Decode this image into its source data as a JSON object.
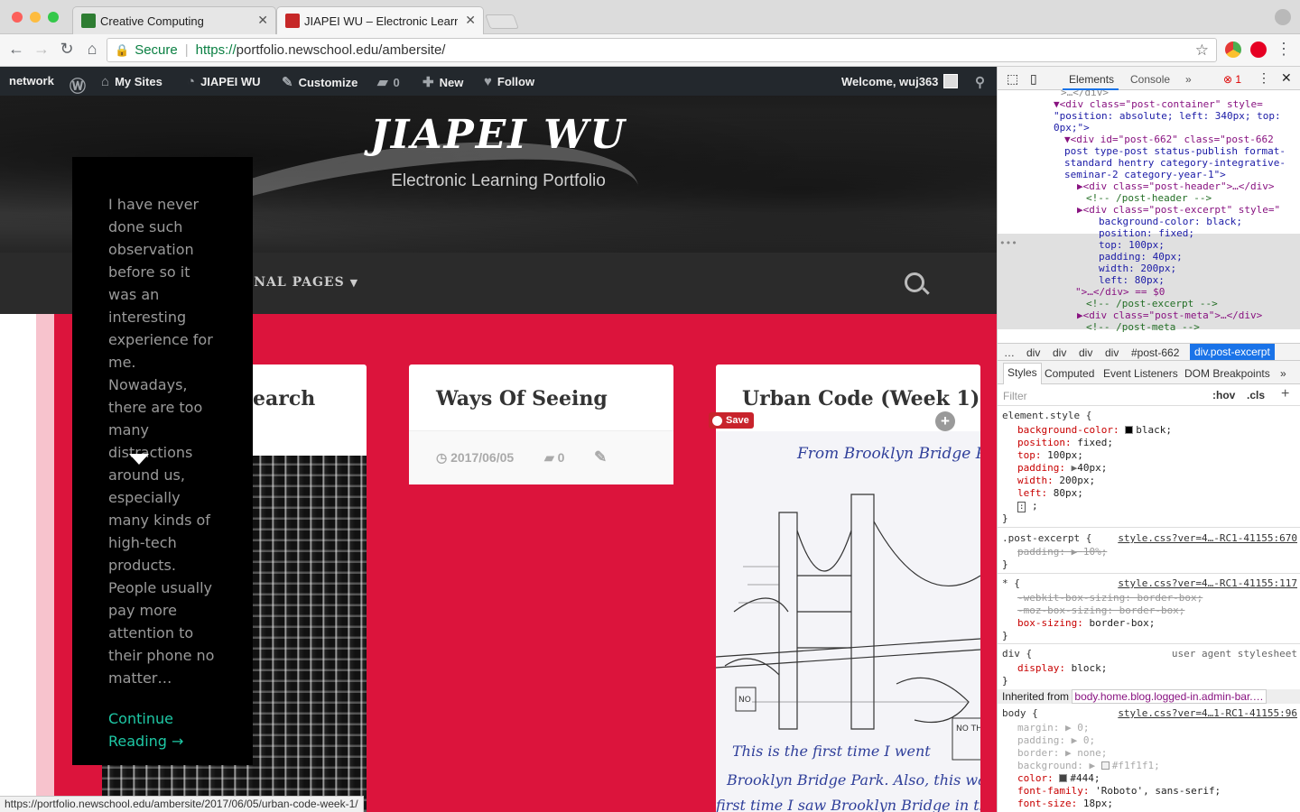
{
  "browser": {
    "tabs": [
      {
        "title": "Creative Computing"
      },
      {
        "title": "JIAPEI WU – Electronic Learnin"
      }
    ],
    "url_secure": "Secure",
    "url_scheme": "https://",
    "url_host": "portfolio.newschool.edu",
    "url_path": "/ambersite/",
    "status_url": "https://portfolio.newschool.edu/ambersite/2017/06/05/urban-code-week-1/"
  },
  "adminbar": {
    "network": "network",
    "my_sites": "My Sites",
    "site_name": "JIAPEI WU",
    "customize": "Customize",
    "comments_count": "0",
    "new": "New",
    "follow": "Follow",
    "welcome": "Welcome, wuj363"
  },
  "header": {
    "title": "JIAPEI WU",
    "description": "Electronic Learning Portfolio"
  },
  "menu": {
    "item": "ONAL PAGES"
  },
  "excerpt": {
    "text": "I have never done such observation before so it was an interesting experience for me. Nowadays, there are too many distractions around us, especially many kinds of high-tech products. People usually pay more attention to their phone no matter…",
    "continue": "Continue Reading →"
  },
  "cards": [
    {
      "title": "earch"
    },
    {
      "title": "Ways Of Seeing",
      "date": "2017/06/05",
      "comments": "0"
    },
    {
      "title": "Urban Code (Week 1)",
      "save_label": "Save"
    }
  ],
  "sketch_text": {
    "top": "From Brooklyn Bridge Par",
    "l1": "This is the first time I went",
    "l2": "Brooklyn Bridge Park. Also, this was th",
    "l3": "first time I saw Brooklyn Bridge in thi",
    "sign1": "NO",
    "sign2": "NO THR TRA"
  },
  "devtools": {
    "tabs": {
      "elements": "Elements",
      "console": "Console",
      "more": "»",
      "errors": "1"
    },
    "dom": [
      {
        "k": "gr",
        "t": ">…</div>"
      },
      {
        "k": "tag",
        "t": "▼<div class=\"post-container\" style="
      },
      {
        "k": "av",
        "t": "\"position: absolute; left: 340px; top:"
      },
      {
        "k": "av",
        "t": "0px;\">"
      },
      {
        "k": "tag",
        "t": "▼<div id=\"post-662\" class=\"post-662"
      },
      {
        "k": "av",
        "t": "post type-post status-publish format-"
      },
      {
        "k": "av",
        "t": "standard hentry category-integrative-"
      },
      {
        "k": "av",
        "t": "seminar-2 category-year-1\">"
      },
      {
        "k": "tag",
        "t": "▶<div class=\"post-header\">…</div>"
      },
      {
        "k": "cm",
        "t": "<!-- /post-header -->"
      },
      {
        "k": "tag",
        "t": "▶<div class=\"post-excerpt\" style=\""
      },
      {
        "k": "av",
        "t": "background-color: black;"
      },
      {
        "k": "av",
        "t": "position: fixed;"
      },
      {
        "k": "av",
        "t": "top: 100px;"
      },
      {
        "k": "av",
        "t": "padding: 40px;"
      },
      {
        "k": "av",
        "t": "width: 200px;"
      },
      {
        "k": "av",
        "t": "left: 80px;"
      },
      {
        "k": "tag",
        "t": "\">…</div> == $0"
      },
      {
        "k": "cm",
        "t": "<!-- /post-excerpt -->"
      },
      {
        "k": "tag",
        "t": "▶<div class=\"post-meta\">…</div>"
      },
      {
        "k": "cm",
        "t": "<!-- /post-meta -->"
      }
    ],
    "crumbs": [
      "…",
      "div",
      "div",
      "div",
      "div",
      "#post-662",
      "div.post-excerpt"
    ],
    "style_tabs": [
      "Styles",
      "Computed",
      "Event Listeners",
      "DOM Breakpoints",
      "»"
    ],
    "filter": "Filter",
    "hov": ":hov",
    "cls": ".cls",
    "rules": {
      "element_sel": "element.style {",
      "e1": "background-color:",
      "e1v": "black;",
      "e2": "position:",
      "e2v": "fixed;",
      "e3": "top:",
      "e3v": "100px;",
      "e4": "padding:",
      "e4v": "40px;",
      "e5": "width:",
      "e5v": "200px;",
      "e6": "left:",
      "e6v": "80px;",
      "e7": ";",
      "close": "}",
      "pe_sel": ".post-excerpt {",
      "pe_src": "style.css?ver=4…-RC1-41155:670",
      "pe1": "padding:",
      "pe1v": "10%;",
      "star_sel": "* {",
      "star_src": "style.css?ver=4…-RC1-41155:117",
      "s1": "-webkit-box-sizing: border-box;",
      "s2": "-moz-box-sizing: border-box;",
      "s3": "box-sizing:",
      "s3v": "border-box;",
      "div_sel": "div {",
      "div_src": "user agent stylesheet",
      "d1": "display:",
      "d1v": "block;",
      "inh_label": "Inherited from",
      "inh_sel": "body.home.blog.logged-in.admin-bar.…",
      "body_sel": "body {",
      "body_src": "style.css?ver=4…1-RC1-41155:96",
      "b1": "margin:",
      "b1v": "0;",
      "b2": "padding:",
      "b2v": "0;",
      "b3": "border:",
      "b3v": "none;",
      "b4": "background:",
      "b4v": "#f1f1f1;",
      "b5": "color:",
      "b5v": "#444;",
      "b6": "font-family:",
      "b6v": "'Roboto', sans-serif;",
      "b7": "font-size:",
      "b7v": "18px;"
    }
  },
  "colors": {
    "accent_red": "#dc143c",
    "excerpt_link": "#1ec8a5",
    "admin_bar": "#23282d"
  }
}
